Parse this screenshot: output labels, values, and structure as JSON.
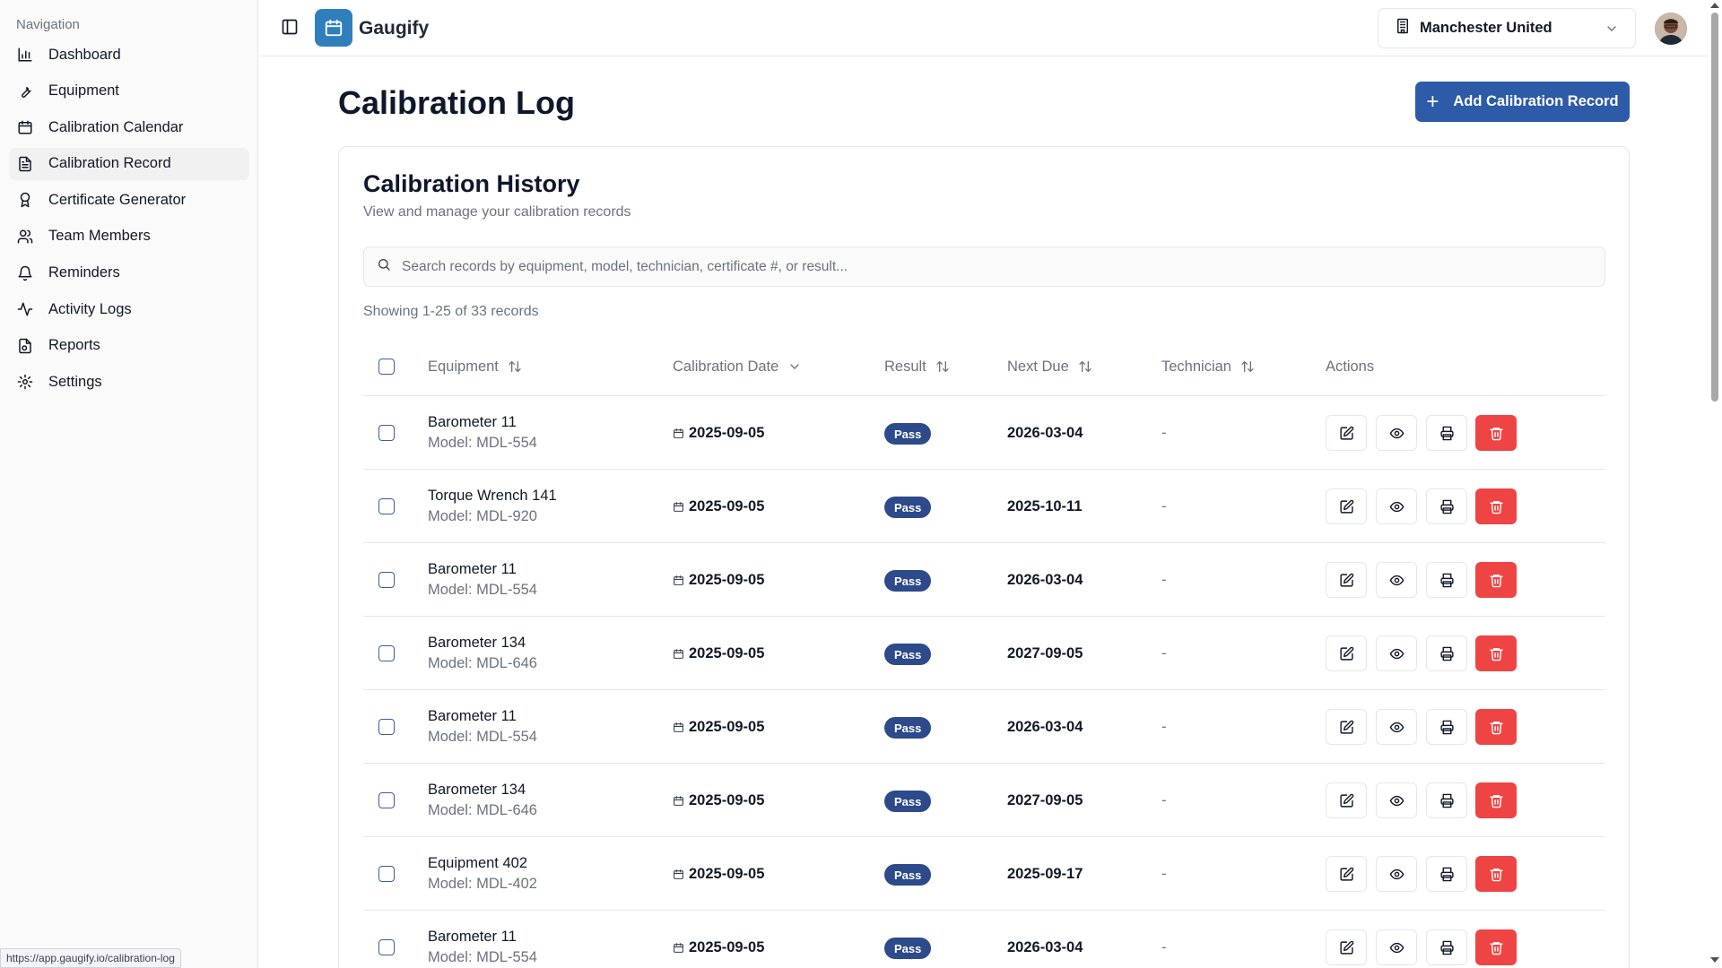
{
  "sidebar": {
    "heading": "Navigation",
    "items": [
      {
        "label": "Dashboard",
        "icon": "bar-chart-icon"
      },
      {
        "label": "Equipment",
        "icon": "wrench-icon"
      },
      {
        "label": "Calibration Calendar",
        "icon": "calendar-icon"
      },
      {
        "label": "Calibration Record",
        "icon": "file-text-icon",
        "active": true
      },
      {
        "label": "Certificate Generator",
        "icon": "award-icon"
      },
      {
        "label": "Team Members",
        "icon": "users-icon"
      },
      {
        "label": "Reminders",
        "icon": "bell-icon"
      },
      {
        "label": "Activity Logs",
        "icon": "activity-icon"
      },
      {
        "label": "Reports",
        "icon": "report-icon"
      },
      {
        "label": "Settings",
        "icon": "gear-icon"
      }
    ]
  },
  "header": {
    "app_name": "Gaugify",
    "organization": "Manchester United"
  },
  "main": {
    "title": "Calibration Log",
    "add_button": "Add Calibration Record",
    "card": {
      "title": "Calibration History",
      "subtitle": "View and manage your calibration records",
      "search_placeholder": "Search records by equipment, model, technician, certificate #, or result...",
      "showing": "Showing 1-25 of 33 records"
    },
    "columns": {
      "equipment": "Equipment",
      "calibration_date": "Calibration Date",
      "result": "Result",
      "next_due": "Next Due",
      "technician": "Technician",
      "actions": "Actions"
    },
    "rows": [
      {
        "name": "Barometer 11",
        "model": "Model: MDL-554",
        "date": "2025-09-05",
        "result": "Pass",
        "next_due": "2026-03-04",
        "technician": "-"
      },
      {
        "name": "Torque Wrench 141",
        "model": "Model: MDL-920",
        "date": "2025-09-05",
        "result": "Pass",
        "next_due": "2025-10-11",
        "technician": "-"
      },
      {
        "name": "Barometer 11",
        "model": "Model: MDL-554",
        "date": "2025-09-05",
        "result": "Pass",
        "next_due": "2026-03-04",
        "technician": "-"
      },
      {
        "name": "Barometer 134",
        "model": "Model: MDL-646",
        "date": "2025-09-05",
        "result": "Pass",
        "next_due": "2027-09-05",
        "technician": "-"
      },
      {
        "name": "Barometer 11",
        "model": "Model: MDL-554",
        "date": "2025-09-05",
        "result": "Pass",
        "next_due": "2026-03-04",
        "technician": "-"
      },
      {
        "name": "Barometer 134",
        "model": "Model: MDL-646",
        "date": "2025-09-05",
        "result": "Pass",
        "next_due": "2027-09-05",
        "technician": "-"
      },
      {
        "name": "Equipment 402",
        "model": "Model: MDL-402",
        "date": "2025-09-05",
        "result": "Pass",
        "next_due": "2025-09-17",
        "technician": "-"
      },
      {
        "name": "Barometer 11",
        "model": "Model: MDL-554",
        "date": "2025-09-05",
        "result": "Pass",
        "next_due": "2026-03-04",
        "technician": "-"
      }
    ]
  },
  "status_url": "https://app.gaugify.io/calibration-log",
  "colors": {
    "primary": "#2d5ba8",
    "badge": "#2d4a8a",
    "danger": "#ef4444",
    "logo": "#2f7fbd"
  }
}
